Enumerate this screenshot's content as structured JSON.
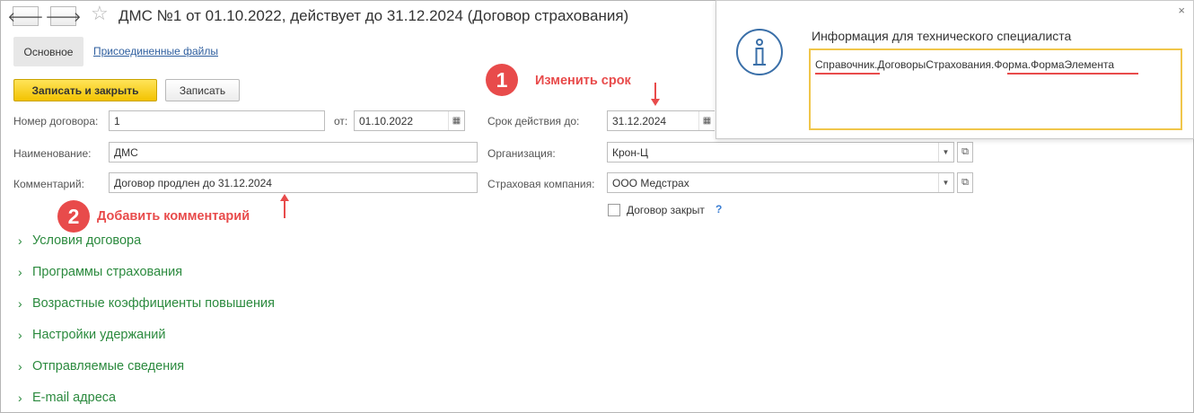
{
  "window": {
    "title": "ДМС №1 от 01.10.2022, действует до 31.12.2024 (Договор страхования)",
    "back_icon": "arrow-left-icon",
    "forward_icon": "arrow-right-icon",
    "favorite_icon": "star-icon"
  },
  "tabs": {
    "main": "Основное",
    "files": "Присоединенные файлы"
  },
  "toolbar": {
    "save_close": "Записать и закрыть",
    "save": "Записать"
  },
  "form": {
    "number_label": "Номер договора:",
    "number_value": "1",
    "from_label": "от:",
    "from_value": "01.10.2022",
    "name_label": "Наименование:",
    "name_value": "ДМС",
    "comment_label": "Комментарий:",
    "comment_value": "Договор продлен до 31.12.2024",
    "term_label": "Срок действия до:",
    "term_value": "31.12.2024",
    "org_label": "Организация:",
    "org_value": "Крон-Ц",
    "insurer_label": "Страховая компания:",
    "insurer_value": "ООО Медстрах",
    "closed_label": "Договор закрыт",
    "help": "?"
  },
  "sections": [
    "Условия договора",
    "Программы страхования",
    "Возрастные коэффициенты повышения",
    "Настройки удержаний",
    "Отправляемые сведения",
    "E-mail адреса"
  ],
  "annotations": {
    "one_number": "1",
    "one_text": "Изменить срок",
    "two_number": "2",
    "two_text": "Добавить комментарий"
  },
  "popup": {
    "title": "Информация для технического специалиста",
    "path": "Справочник.ДоговорыСтрахования.Форма.ФормаЭлемента",
    "close": "×"
  },
  "colors": {
    "accent_yellow": "#f3c300",
    "section_green": "#2b8a3e",
    "annotation_red": "#e84b4b",
    "link_blue": "#2f5f9f",
    "popup_border": "#f0c64a"
  }
}
